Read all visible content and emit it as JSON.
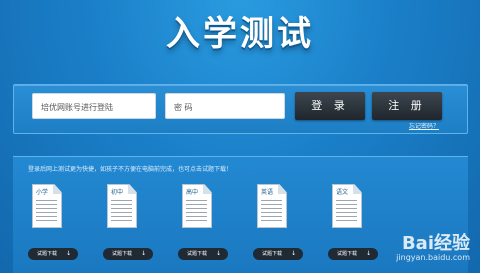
{
  "page": {
    "title": "入学测试"
  },
  "login": {
    "account_placeholder": "培优网账号进行登陆",
    "password_placeholder": "密 码",
    "login_label": "登 录",
    "register_label": "注 册",
    "forgot_label": "忘记密码？"
  },
  "exam": {
    "tip": "登录后网上测试更为快捷，如孩子不方便在电脑前完成，也可点击试题下载！",
    "download_label": "试题下载",
    "download_icon": "down-arrow-icon",
    "subjects": [
      {
        "label": "小学"
      },
      {
        "label": "初中"
      },
      {
        "label": "高中"
      },
      {
        "label": "英语"
      },
      {
        "label": "语文"
      }
    ]
  },
  "watermark": {
    "logo": "Bai经验",
    "url": "jingyan.baidu.com"
  },
  "colors": {
    "background": "#1a7fc8",
    "button": "#2a323a",
    "panel": "#2389d2"
  }
}
